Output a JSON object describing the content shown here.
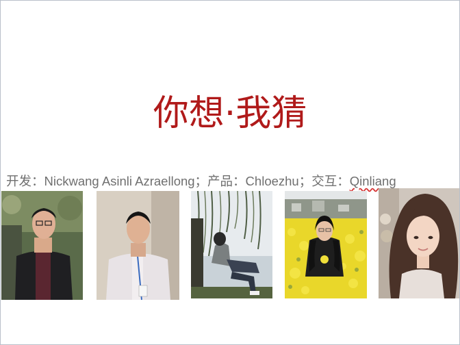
{
  "slide": {
    "title": "你想·我猜",
    "credits_text": "开发：Nickwang  Asinli  Azraellong；产品：Chloezhu；交互：",
    "credits_last": "Qinliang",
    "title_color": "#b01a1a",
    "credits_color": "#6f6f6f"
  },
  "photos": [
    {
      "subject": "young man in dark jacket and glasses"
    },
    {
      "subject": "man in light shirt with lanyard"
    },
    {
      "subject": "man sitting under a willow tree by the lake"
    },
    {
      "subject": "woman in a yellow rapeseed flower field"
    },
    {
      "subject": "young woman with long hair, close portrait"
    }
  ]
}
